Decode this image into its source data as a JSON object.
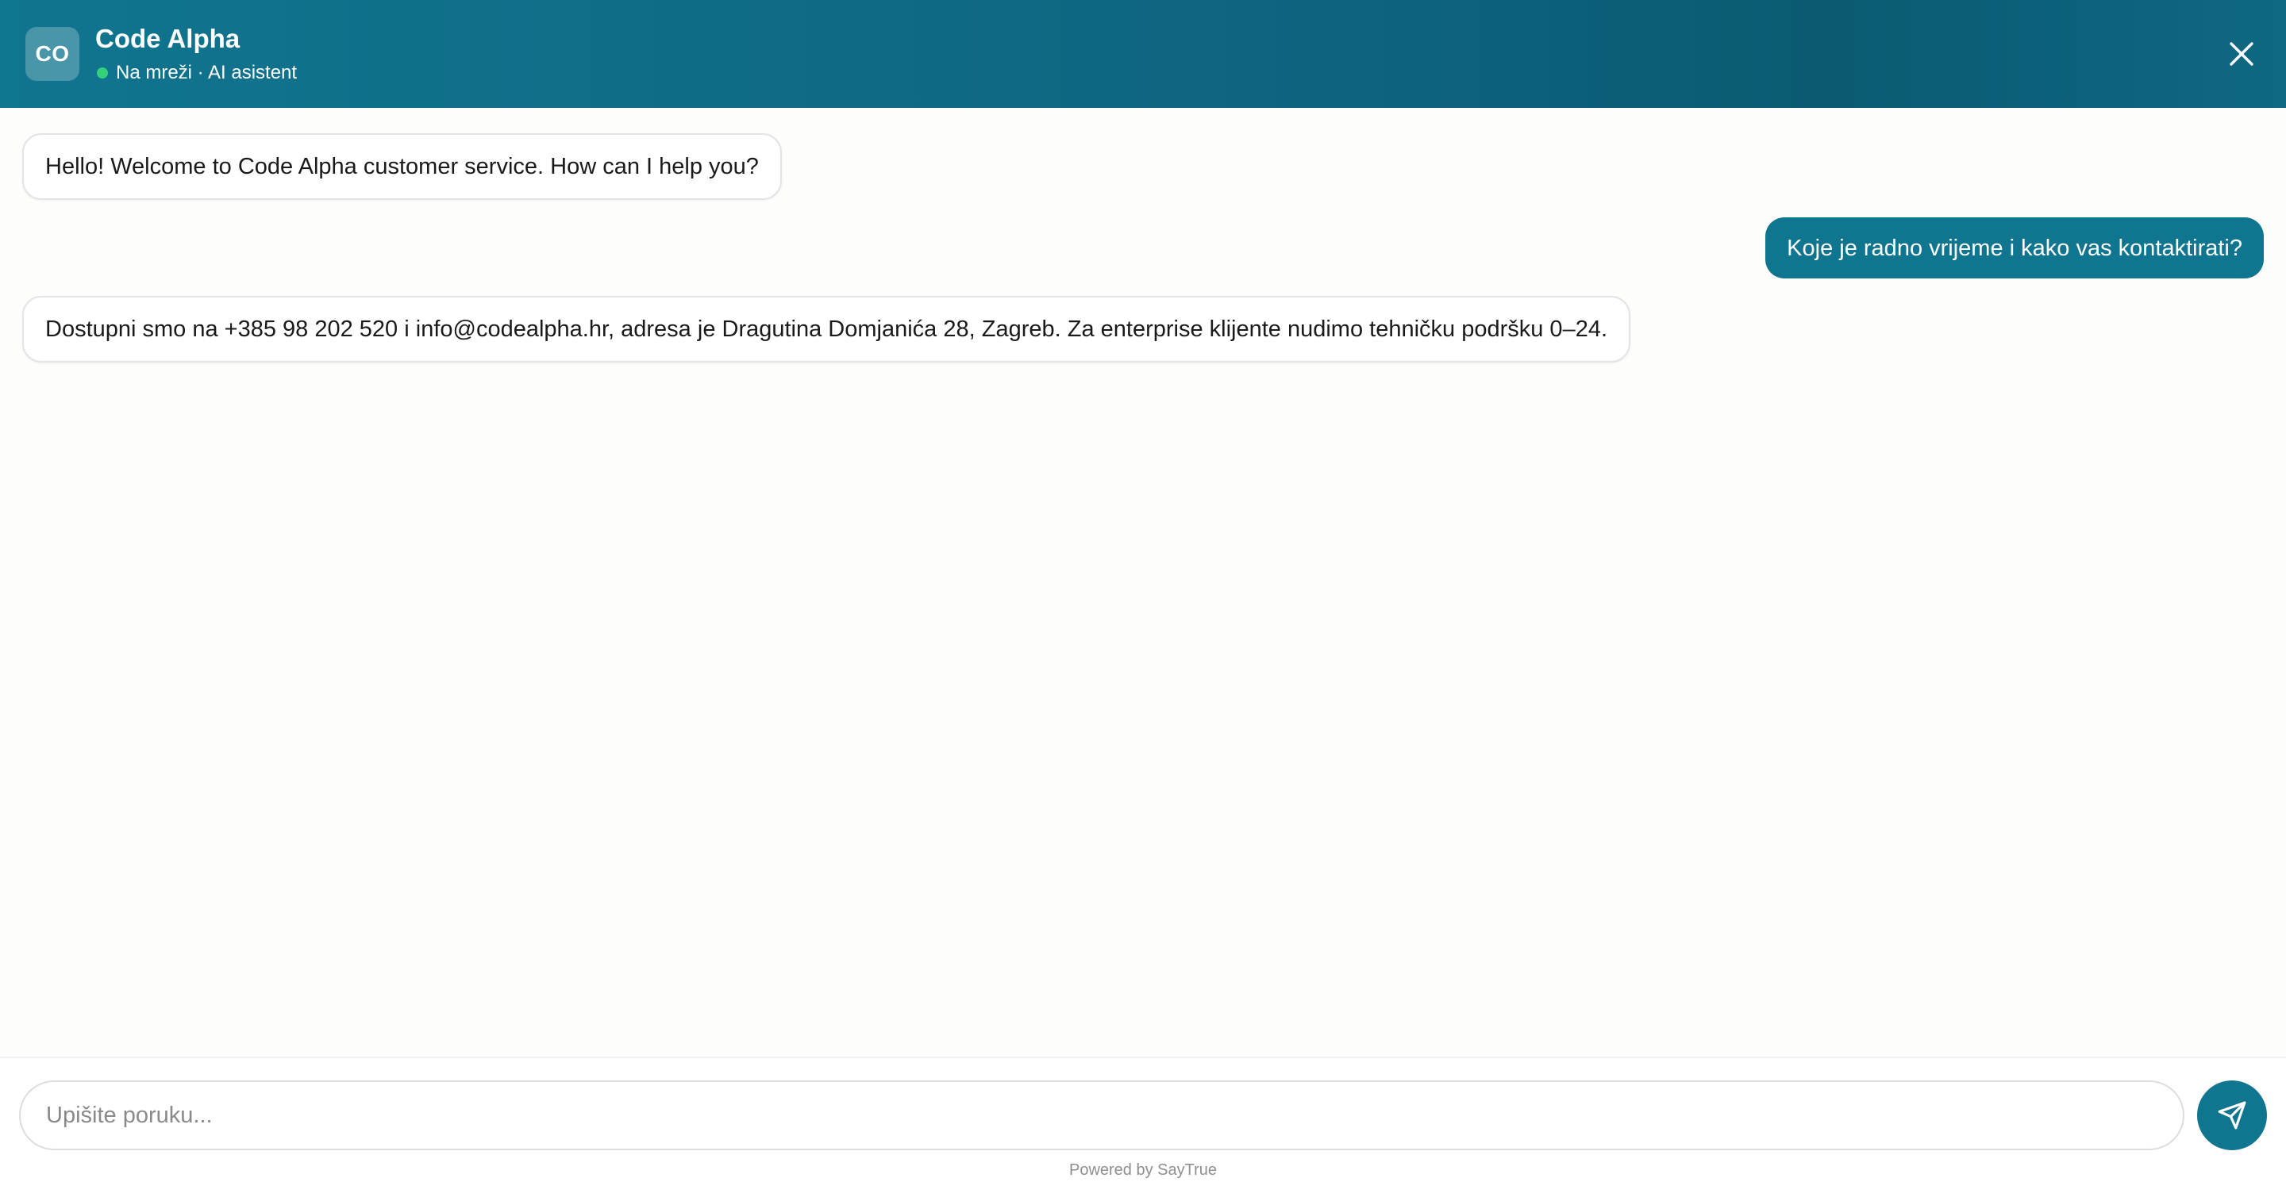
{
  "header": {
    "avatar_text": "CO",
    "title": "Code Alpha",
    "status": "Na mreži · AI asistent",
    "status_color": "#34d17a",
    "background": "#10758f",
    "close_icon": "close-icon"
  },
  "messages": [
    {
      "role": "bot",
      "text": "Hello! Welcome to Code Alpha customer service. How can I help you?"
    },
    {
      "role": "user",
      "text": "Koje je radno vrijeme i kako vas kontaktirati?"
    },
    {
      "role": "bot",
      "text": "Dostupni smo na +385 98 202 520 i info@codealpha.hr, adresa je Dragutina Domjanića 28, Zagreb. Za enterprise klijente nudimo tehničku podršku 0–24."
    }
  ],
  "composer": {
    "placeholder": "Upišite poruku...",
    "value": "",
    "send_icon": "send-icon",
    "accent": "#10758f"
  },
  "footer": {
    "powered_by": "Powered by SayTrue"
  }
}
